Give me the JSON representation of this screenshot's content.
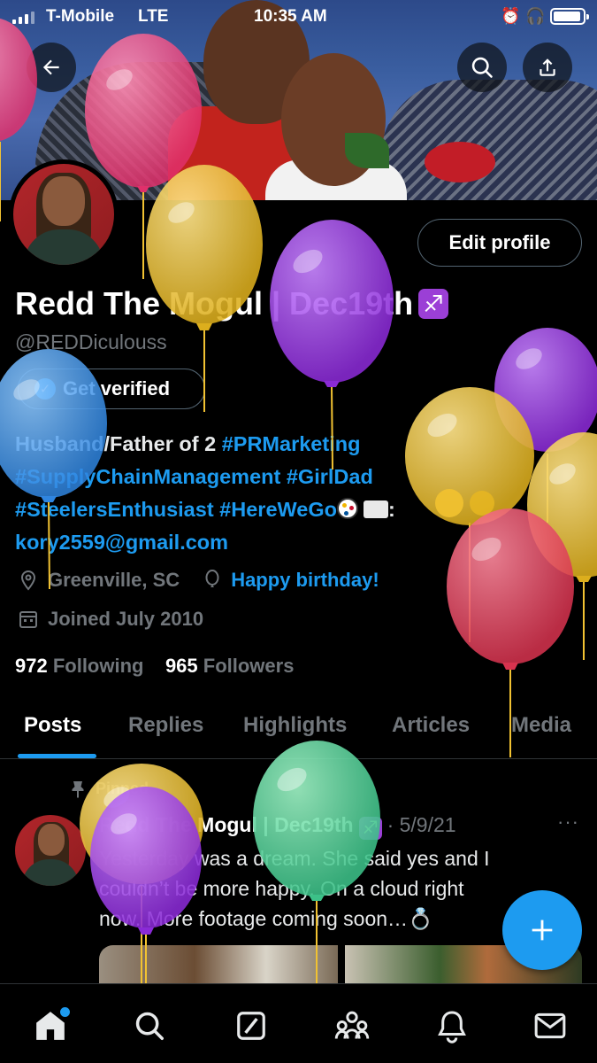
{
  "status_bar": {
    "carrier": "T-Mobile",
    "network": "LTE",
    "time": "10:35 AM"
  },
  "profile": {
    "edit_label": "Edit profile",
    "display_name": "Redd The Mogul | Dec19th",
    "zodiac": "♐",
    "handle": "@REDDiculouss",
    "get_verified": "Get verified",
    "bio": {
      "line1_text": "Husband/Father of 2 ",
      "line1_tag": "#PRMarketing",
      "line2_tag1": "#SupplyChainManagement",
      "line2_tag2": " #GirlDad",
      "line3_tag1": "#SteelersEnthusiast",
      "line3_tag2": " #HereWeGo",
      "line3_tail": ":",
      "line4_email": "kory2559@gmail.com"
    },
    "location": "Greenville, SC",
    "birthday": "Happy birthday!",
    "joined": "Joined July 2010",
    "following_count": "972",
    "following_label": " Following",
    "followers_count": "965",
    "followers_label": " Followers"
  },
  "tabs": [
    {
      "label": "Posts",
      "active": true
    },
    {
      "label": "Replies",
      "active": false
    },
    {
      "label": "Highlights",
      "active": false
    },
    {
      "label": "Articles",
      "active": false
    },
    {
      "label": "Media",
      "active": false
    }
  ],
  "post": {
    "pinned_label": "Pinned",
    "author": "Redd The Mogul | Dec19th",
    "zodiac": "♐",
    "date": "· 5/9/21",
    "more": "···",
    "text_line1": "Yesterday was a dream. She said yes and I",
    "text_line2": "couldn’t be more happy. On a cloud right",
    "text_line3": "now. More footage coming soon…💍"
  },
  "colors": {
    "accent": "#1d9bf0",
    "muted": "#71767b",
    "border": "#536471",
    "zodiac_badge": "#9b3fd6"
  },
  "icons": [
    "back-arrow-icon",
    "search-icon",
    "share-icon",
    "location-pin-icon",
    "balloon-icon",
    "calendar-icon",
    "pin-icon",
    "compose-plus-icon",
    "home-icon",
    "explore-search-icon",
    "grok-icon",
    "communities-icon",
    "notifications-icon",
    "messages-icon"
  ]
}
